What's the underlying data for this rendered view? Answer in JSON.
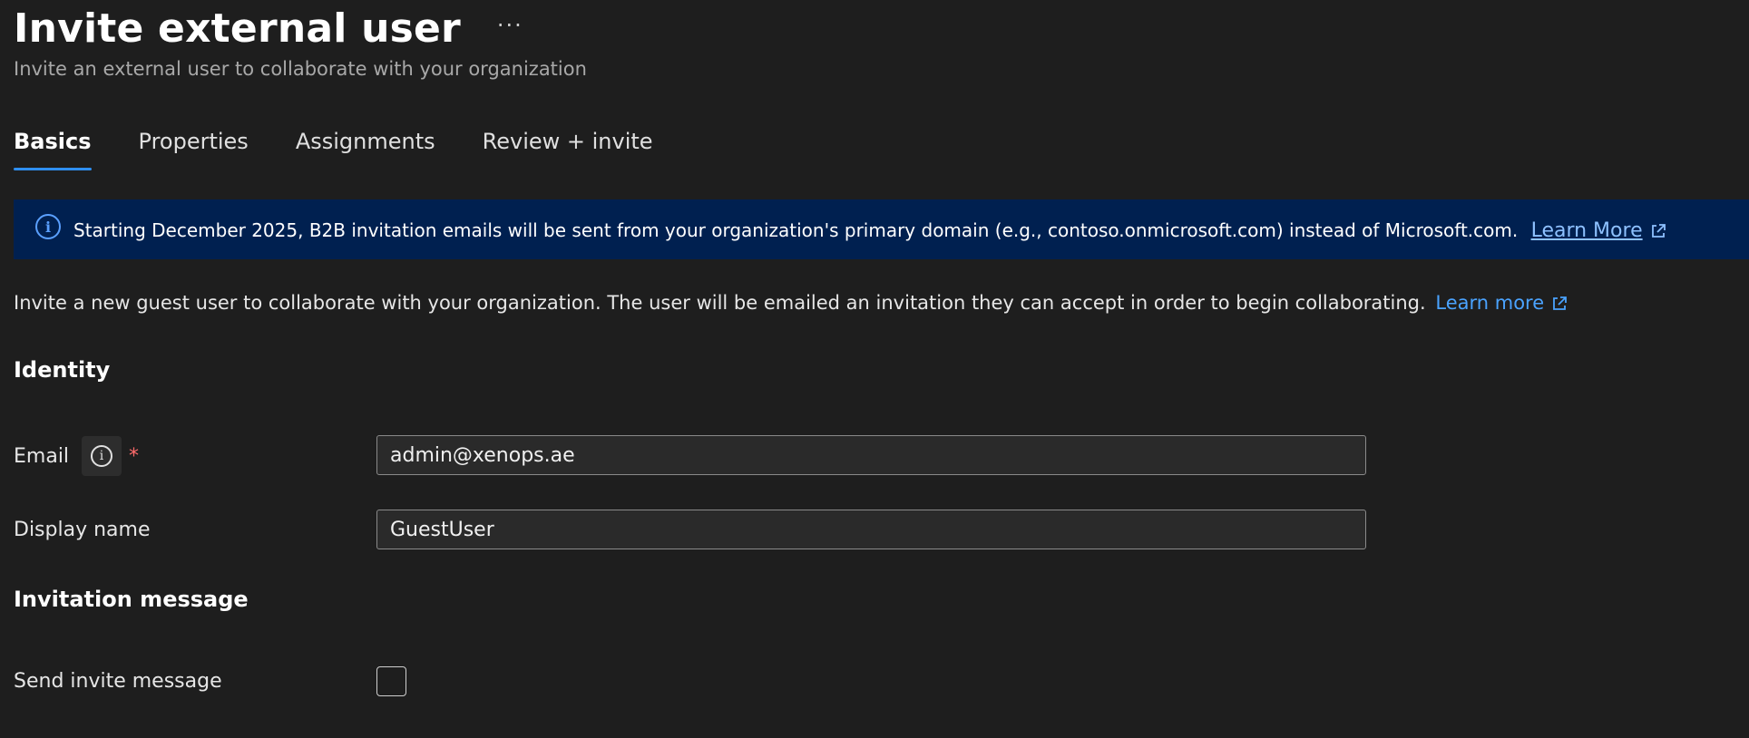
{
  "header": {
    "title": "Invite external user",
    "more_label": "···",
    "subtitle": "Invite an external user to collaborate with your organization"
  },
  "tabs": [
    {
      "label": "Basics",
      "active": true
    },
    {
      "label": "Properties",
      "active": false
    },
    {
      "label": "Assignments",
      "active": false
    },
    {
      "label": "Review + invite",
      "active": false
    }
  ],
  "banner": {
    "text": "Starting December 2025, B2B invitation emails will be sent from your organization's primary domain (e.g., contoso.onmicrosoft.com) instead of Microsoft.com.",
    "link": "Learn More",
    "icon": "info-icon"
  },
  "description": {
    "text": "Invite a new guest user to collaborate with your organization. The user will be emailed an invitation they can accept in order to begin collaborating.",
    "link": "Learn more"
  },
  "identity": {
    "heading": "Identity",
    "email_label": "Email",
    "required_mark": "*",
    "email_value": "admin@xenops.ae",
    "display_name_label": "Display name",
    "display_name_value": "GuestUser"
  },
  "invitation": {
    "heading": "Invitation message",
    "send_label": "Send invite message",
    "send_checked": false
  },
  "colors": {
    "background": "#1e1e1e",
    "banner": "#002050",
    "accent": "#2f8ff0",
    "link": "#4aa3ff",
    "required": "#ff6b6b"
  }
}
